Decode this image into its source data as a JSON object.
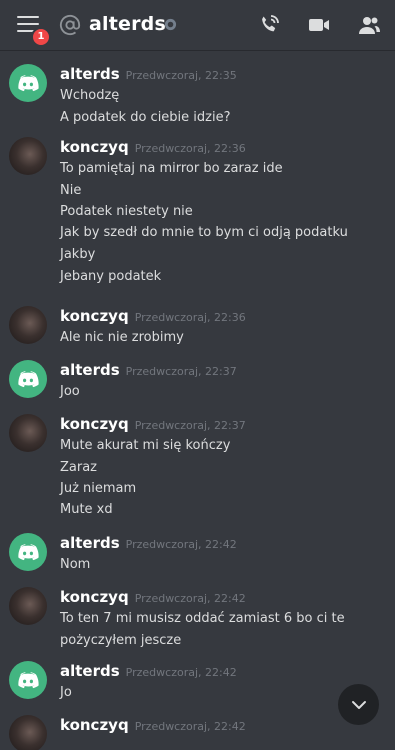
{
  "header": {
    "channel_name": "alterds",
    "notification_count": "1",
    "icons": [
      "menu-icon",
      "at-icon",
      "status-icon",
      "phone-call-icon",
      "video-call-icon",
      "members-icon"
    ]
  },
  "messages": [
    {
      "author": "alterds",
      "timestamp": "Przedwczoraj, 22:35",
      "avatar": "discord",
      "lines": [
        "Wchodzę",
        "A podatek do ciebie idzie?"
      ]
    },
    {
      "author": "konczyq",
      "timestamp": "Przedwczoraj, 22:36",
      "avatar": "photo",
      "lines": [
        "To pamiętaj na mirror bo zaraz ide",
        "Nie",
        "Podatek niestety nie",
        "Jak by szedł do mnie to bym ci odją podatku",
        "Jakby",
        "Jebany podatek"
      ]
    },
    {
      "author": "konczyq",
      "timestamp": "Przedwczoraj, 22:36",
      "avatar": "photo",
      "lines": [
        "Ale nic nie zrobimy"
      ]
    },
    {
      "author": "alterds",
      "timestamp": "Przedwczoraj, 22:37",
      "avatar": "discord",
      "lines": [
        "Joo"
      ]
    },
    {
      "author": "konczyq",
      "timestamp": "Przedwczoraj, 22:37",
      "avatar": "photo",
      "lines": [
        "Mute akurat mi się kończy",
        "Zaraz",
        "Już niemam",
        "Mute xd"
      ]
    },
    {
      "author": "alterds",
      "timestamp": "Przedwczoraj, 22:42",
      "avatar": "discord",
      "lines": [
        "Nom"
      ]
    },
    {
      "author": "konczyq",
      "timestamp": "Przedwczoraj, 22:42",
      "avatar": "photo",
      "lines": [
        "To ten 7 mi musisz oddać zamiast 6 bo ci te",
        "pożyczyłem jescze"
      ]
    },
    {
      "author": "alterds",
      "timestamp": "Przedwczoraj, 22:42",
      "avatar": "discord",
      "lines": [
        "Jo"
      ]
    },
    {
      "author": "konczyq",
      "timestamp": "Przedwczoraj, 22:42",
      "avatar": "photo",
      "lines": []
    }
  ],
  "colors": {
    "background": "#36393f",
    "discord_green": "#43b581",
    "badge_red": "#f04747",
    "timestamp_gray": "#72767d"
  }
}
